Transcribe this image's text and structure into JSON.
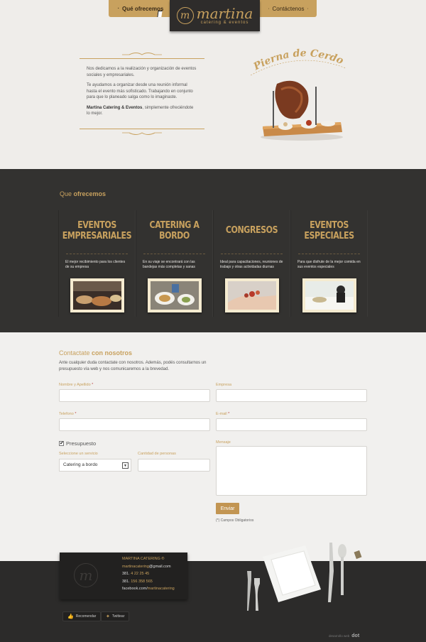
{
  "nav": {
    "left_label": "Qué ofrecemos",
    "right_label": "Contáctenos",
    "separator": "·"
  },
  "logo": {
    "monogram": "m",
    "name": "martina",
    "tagline": "catering & eventos"
  },
  "intro": {
    "p1": "Nos dedicamos a la realización y organización de eventos sociales y empresariales.",
    "p2": "Te ayudamos a organizar desde una reunión informal hasta el evento más sofisticado. Trabajando en conjunto para que lo planeado salga como lo imaginaste.",
    "p3_bold": "Martina Catering & Eventos",
    "p3_rest": ", simplemente ofreciéndote lo mejor."
  },
  "featured": {
    "title": "Pierna de Cerdo"
  },
  "services": {
    "heading_plain": "Que ",
    "heading_bold": "ofrecemos",
    "items": [
      {
        "title": "EVENTOS EMPRESARIALES",
        "desc": "El mejor recibimiento para los clientes de su empresa"
      },
      {
        "title": "CATERING A BORDO",
        "desc": "En su viaje se encontrará con las bandejas más completas y sanas"
      },
      {
        "title": "CONGRESOS",
        "desc": "Ideal para capacitaciones, reuniones de trabajo y otras actividadas diurnas"
      },
      {
        "title": "EVENTOS ESPECIALES",
        "desc": "Para que disfrute de la mejor comida en sus eventos especiales"
      }
    ]
  },
  "contact": {
    "heading_plain": "Contactate ",
    "heading_bold": "con nosotros",
    "intro": "Ante cualquier duda contactate con nosotros.  Además, podés consultarnos un presupuesto vía web y nos comunicaremos a la brevedad.",
    "name_label": "Nombre y Apellido",
    "company_label": "Empresa",
    "phone_label": "Telefono",
    "email_label": "E-mail",
    "required_mark": "*",
    "budget_label": "Presupuesto",
    "budget_checked": "✔",
    "service_label": "Seleccione un servicio",
    "service_value": "Catering a bordo",
    "people_label": "Cantidad de personas",
    "message_label": "Mensaje",
    "submit_label": "Enviar",
    "required_note": "(*) Campos Obligatorios"
  },
  "footer": {
    "company": "MARTINA CATERING ®",
    "email_user": "martinacatering",
    "email_domain": "@gmail.com",
    "phone1_prefix": "381. ",
    "phone1": "4 22 25 45",
    "phone2_prefix": "381. ",
    "phone2": "156 358 565",
    "facebook_prefix": "facebook.com/",
    "facebook_user": "martinacatering",
    "recommend_label": "Recomendar",
    "tweet_label": "Twittear",
    "credit_label": "desarrollo web",
    "credit_brand": "dot"
  },
  "colors": {
    "gold": "#c8a15e",
    "dark": "#333230",
    "footer": "#2c2b2a",
    "button": "#c29552"
  }
}
